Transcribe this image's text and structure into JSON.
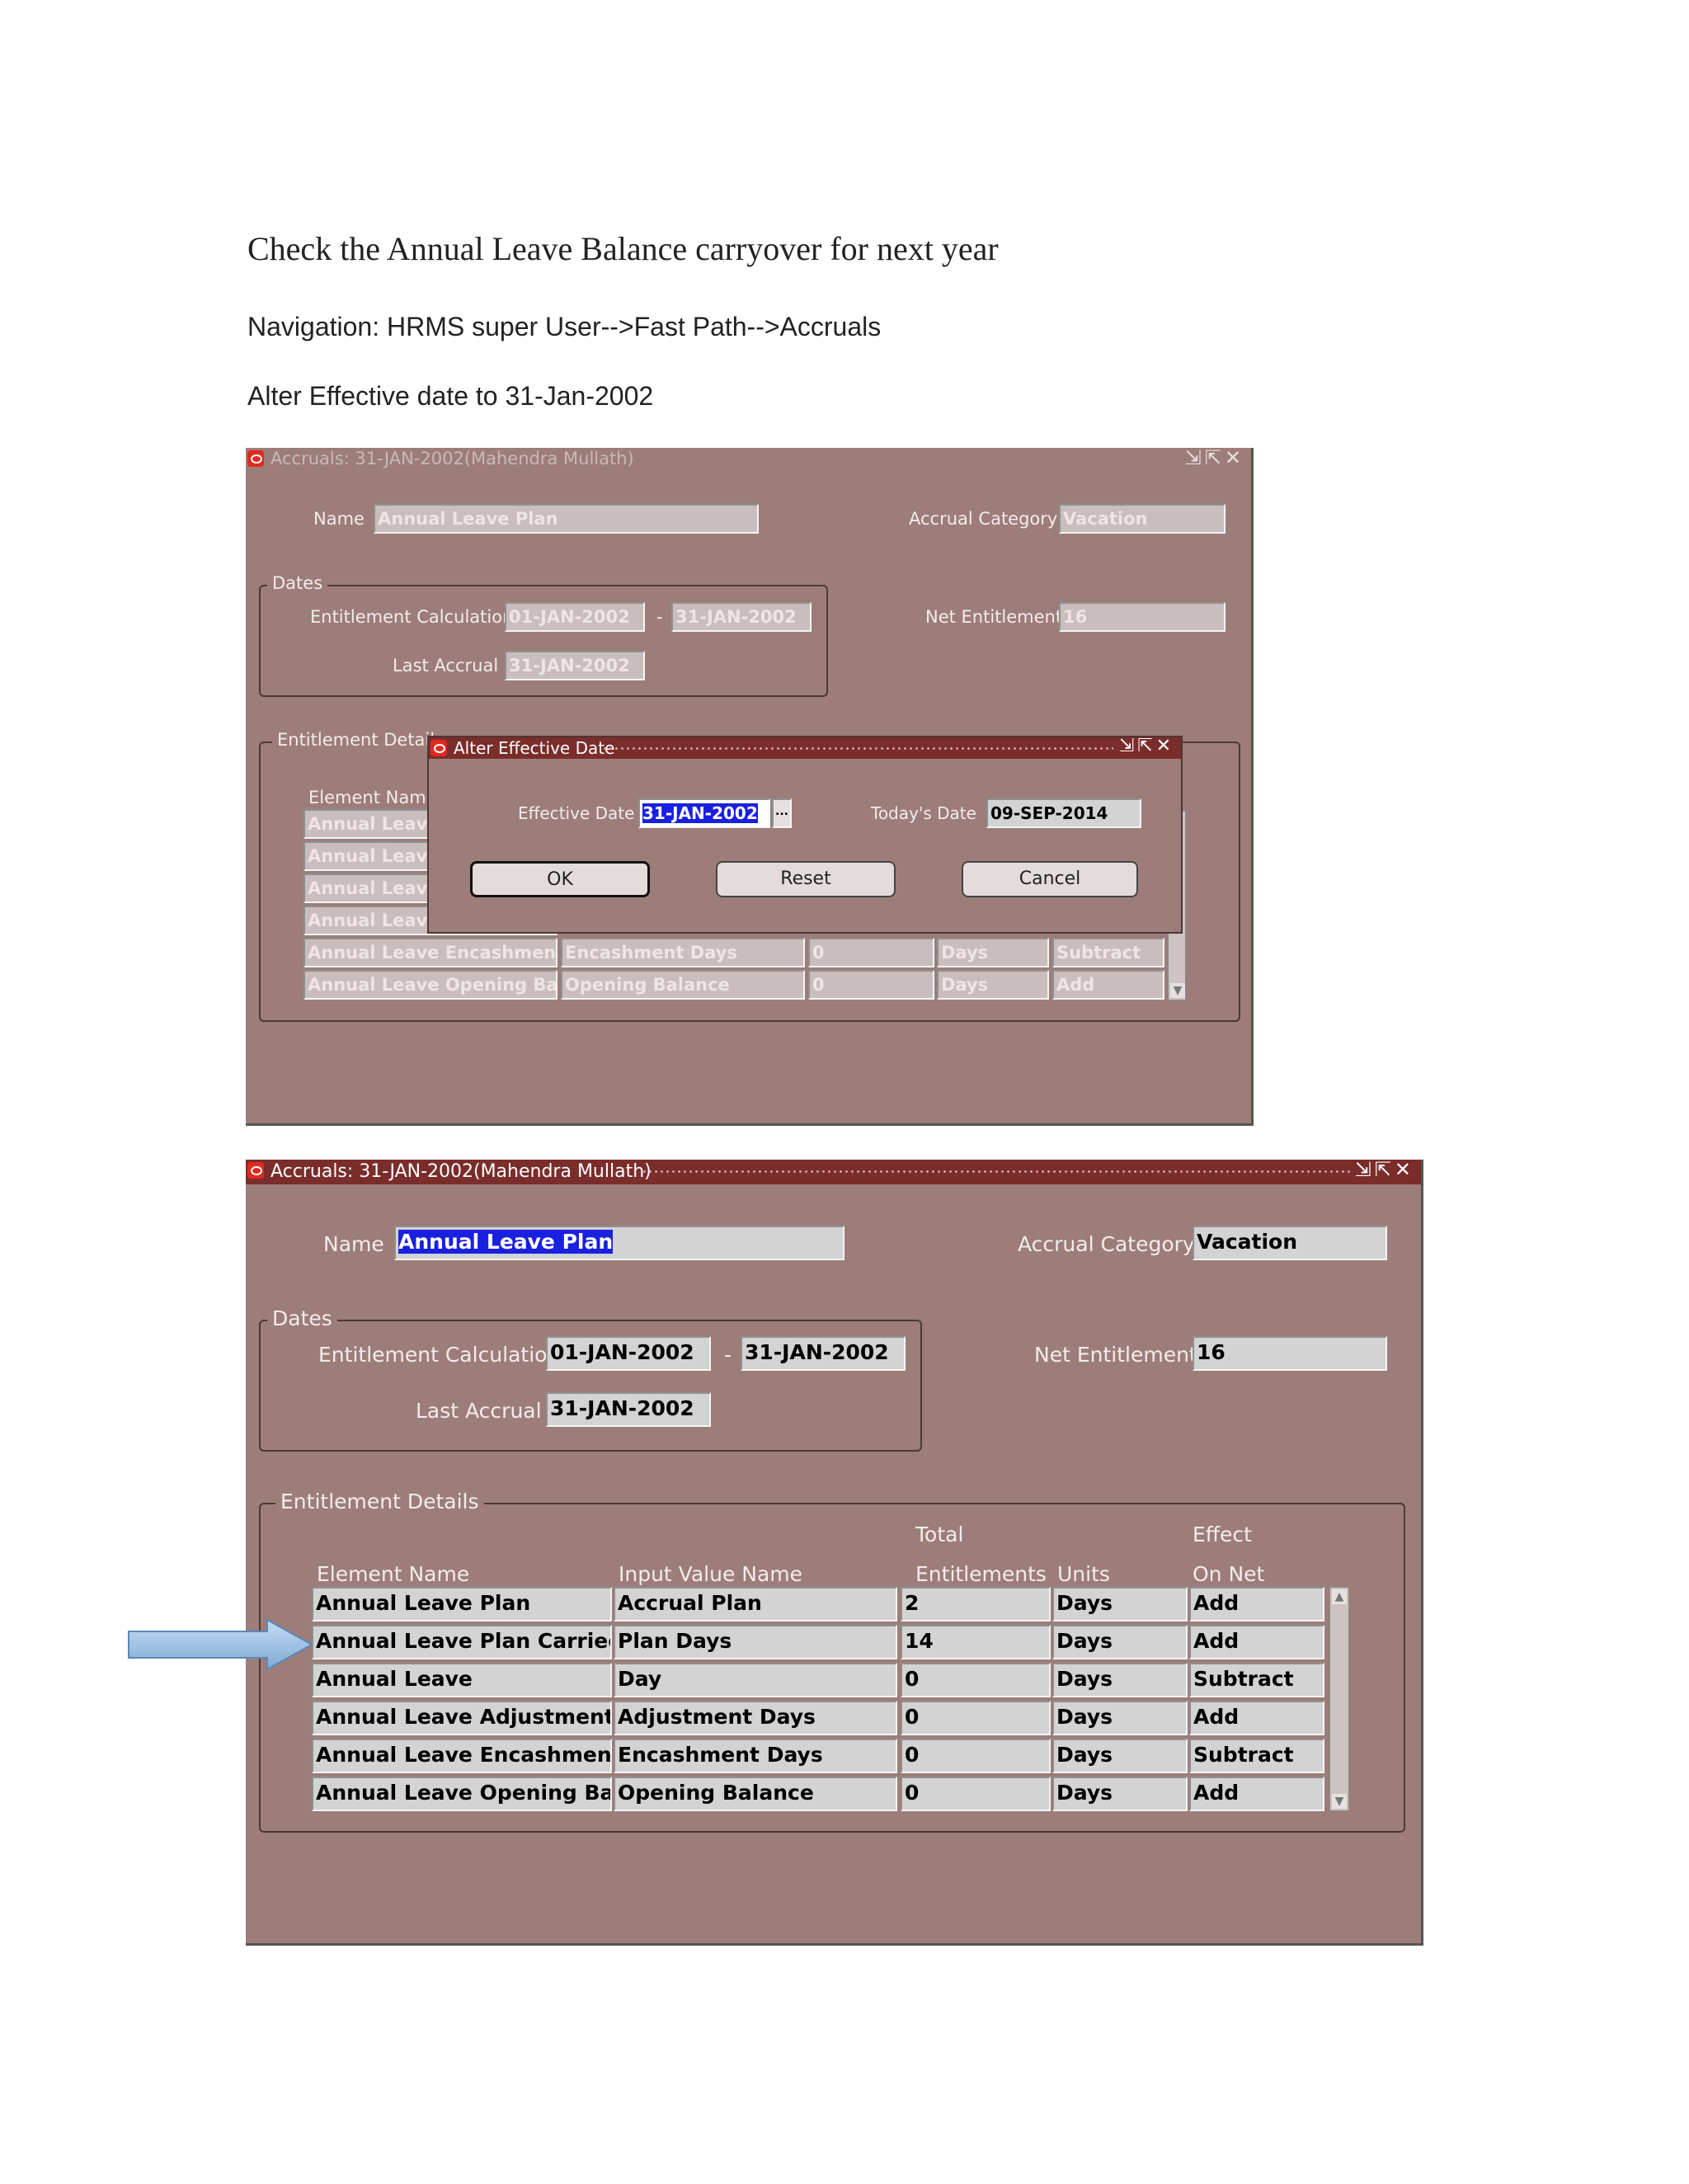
{
  "document": {
    "heading": "Check the Annual Leave Balance carryover for next year",
    "navigation": "Navigation: HRMS super User-->Fast Path-->Accruals",
    "instruction": "Alter Effective date to 31-Jan-2002"
  },
  "window1": {
    "title": "Accruals: 31-JAN-2002(Mahendra Mullath)",
    "name_label": "Name",
    "name_value": "Annual Leave Plan",
    "accrual_category_label": "Accrual Category",
    "accrual_category_value": "Vacation",
    "dates_label": "Dates",
    "entitlement_calc_label": "Entitlement Calculation",
    "entitlement_from": "01-JAN-2002",
    "dash": "-",
    "entitlement_to": "31-JAN-2002",
    "last_accrual_label": "Last Accrual",
    "last_accrual_value": "31-JAN-2002",
    "net_entitlement_label": "Net Entitlement",
    "net_entitlement_value": "16",
    "details_label": "Entitlement Details",
    "element_name_header": "Element Name",
    "visible_rows": [
      {
        "element": "Annual Leave",
        "input": "",
        "total": "",
        "units": "",
        "effect": ""
      },
      {
        "element": "Annual Leave",
        "input": "",
        "total": "",
        "units": "",
        "effect": ""
      },
      {
        "element": "Annual Leave",
        "input": "",
        "total": "",
        "units": "",
        "effect": ""
      },
      {
        "element": "Annual Leave",
        "input": "",
        "total": "",
        "units": "",
        "effect": ""
      },
      {
        "element": "Annual Leave Encashment",
        "input": "Encashment Days",
        "total": "0",
        "units": "Days",
        "effect": "Subtract"
      },
      {
        "element": "Annual Leave Opening Balan",
        "input": "Opening Balance",
        "total": "0",
        "units": "Days",
        "effect": "Add"
      }
    ]
  },
  "dialog": {
    "title": "Alter Effective Date",
    "effective_date_label": "Effective Date",
    "effective_date_value": "31-JAN-2002",
    "lov_button": "...",
    "todays_date_label": "Today's Date",
    "todays_date_value": "09-SEP-2014",
    "ok_label": "OK",
    "reset_label": "Reset",
    "cancel_label": "Cancel"
  },
  "window2": {
    "title": "Accruals: 31-JAN-2002(Mahendra Mullath)",
    "name_label": "Name",
    "name_value": "Annual Leave Plan",
    "accrual_category_label": "Accrual Category",
    "accrual_category_value": "Vacation",
    "dates_label": "Dates",
    "entitlement_calc_label": "Entitlement Calculation",
    "entitlement_from": "01-JAN-2002",
    "dash": "-",
    "entitlement_to": "31-JAN-2002",
    "last_accrual_label": "Last Accrual",
    "last_accrual_value": "31-JAN-2002",
    "net_entitlement_label": "Net Entitlement",
    "net_entitlement_value": "16",
    "details_label": "Entitlement Details",
    "headers": {
      "element_name": "Element Name",
      "input_value_name": "Input Value Name",
      "total_line1": "Total",
      "total_line2": "Entitlements",
      "units": "Units",
      "effect_line1": "Effect",
      "effect_line2": "On Net"
    },
    "rows": [
      {
        "element": "Annual Leave Plan",
        "input": "Accrual Plan",
        "total": "2",
        "units": "Days",
        "effect": "Add"
      },
      {
        "element": "Annual Leave Plan Carried O",
        "input": "Plan Days",
        "total": "14",
        "units": "Days",
        "effect": "Add"
      },
      {
        "element": "Annual Leave",
        "input": "Day",
        "total": "0",
        "units": "Days",
        "effect": "Subtract"
      },
      {
        "element": "Annual Leave Adjustment",
        "input": "Adjustment Days",
        "total": "0",
        "units": "Days",
        "effect": "Add"
      },
      {
        "element": "Annual Leave Encashment",
        "input": "Encashment Days",
        "total": "0",
        "units": "Days",
        "effect": "Subtract"
      },
      {
        "element": "Annual Leave Opening Balan",
        "input": "Opening Balance",
        "total": "0",
        "units": "Days",
        "effect": "Add"
      }
    ]
  },
  "colors": {
    "form_bg": "#9d7d79",
    "active_title": "#7a2d2a",
    "field_bg": "#d3d3d3",
    "selection": "#1a20e0",
    "arrow": "#9dc3e6"
  }
}
